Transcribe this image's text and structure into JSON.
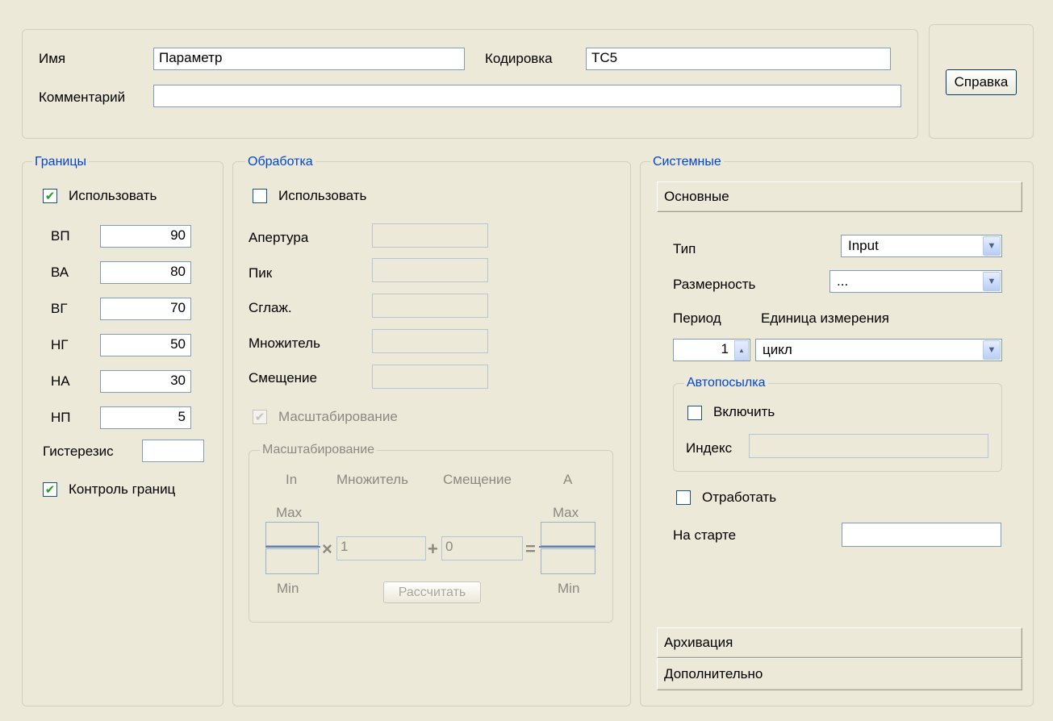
{
  "header": {
    "name_label": "Имя",
    "name_value": "Параметр",
    "encoding_label": "Кодировка",
    "encoding_value": "TC5",
    "comment_label": "Комментарий",
    "comment_value": "",
    "help_button": "Справка"
  },
  "limits": {
    "title": "Границы",
    "use_label": "Использовать",
    "use_checked": true,
    "rows": [
      {
        "label": "ВП",
        "value": "90"
      },
      {
        "label": "ВА",
        "value": "80"
      },
      {
        "label": "ВГ",
        "value": "70"
      },
      {
        "label": "НГ",
        "value": "50"
      },
      {
        "label": "НА",
        "value": "30"
      },
      {
        "label": "НП",
        "value": "5"
      }
    ],
    "hysteresis_label": "Гистерезис",
    "hysteresis_value": "",
    "control_label": "Контроль границ",
    "control_checked": true
  },
  "processing": {
    "title": "Обработка",
    "use_label": "Использовать",
    "use_checked": false,
    "fields": [
      {
        "label": "Апертура",
        "value": ""
      },
      {
        "label": "Пик",
        "value": ""
      },
      {
        "label": "Сглаж.",
        "value": ""
      },
      {
        "label": "Множитель",
        "value": ""
      },
      {
        "label": "Смещение",
        "value": ""
      }
    ],
    "scaling_check_label": "Масштабирование",
    "scaling_checked": true,
    "scaling": {
      "title": "Масштабирование",
      "col_in": "In",
      "col_multiplier": "Множитель",
      "col_offset": "Смещение",
      "col_a": "A",
      "max_label": "Max",
      "min_label": "Min",
      "multiplier_value": "1",
      "offset_value": "0",
      "times_sign": "×",
      "plus_sign": "+",
      "equals_sign": "=",
      "calc_button": "Рассчитать"
    }
  },
  "system": {
    "title": "Системные",
    "main_section": "Основные",
    "type_label": "Тип",
    "type_value": "Input",
    "dimension_label": "Размерность",
    "dimension_value": "...",
    "period_label": "Период",
    "unit_label": "Единица измерения",
    "period_value": "1",
    "unit_value": "цикл",
    "autosend": {
      "title": "Автопосылка",
      "enable_label": "Включить",
      "enable_checked": false,
      "index_label": "Индекс",
      "index_value": ""
    },
    "process_label": "Отработать",
    "process_checked": false,
    "start_label": "На старте",
    "start_value": "",
    "archive_section": "Архивация",
    "extra_section": "Дополнительно"
  }
}
